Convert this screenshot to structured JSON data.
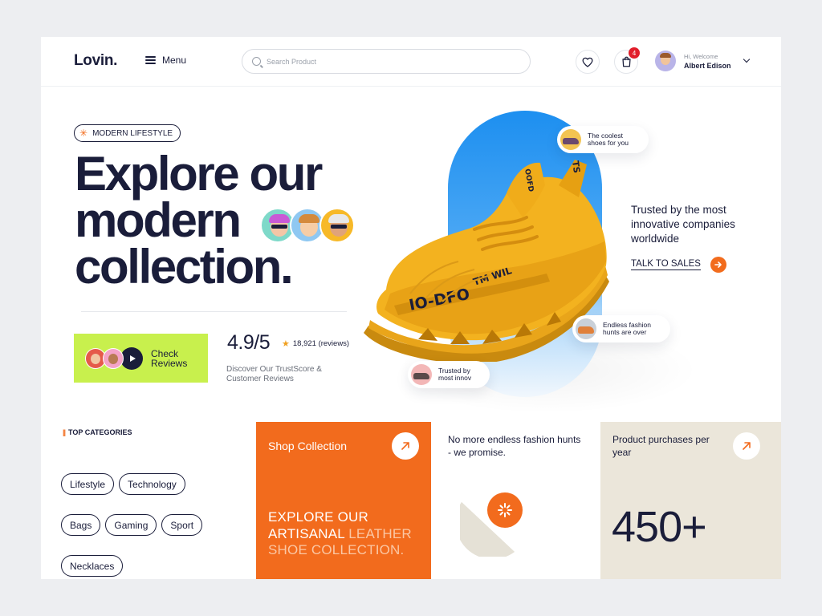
{
  "header": {
    "logo": "Lovin.",
    "menu_label": "Menu",
    "search_placeholder": "Search Product",
    "cart_count": "4",
    "user_greeting": "Hi, Welcome",
    "user_name": "Albert Edison"
  },
  "hero": {
    "tag": "MODERN LIFESTYLE",
    "title_line1": "Explore our",
    "title_line2": "modern",
    "title_line3": "collection.",
    "check_reviews_label": "Check Reviews",
    "rating": "4.9/5",
    "review_count": "18,921 (reviews)",
    "rating_desc": "Discover Our TrustScore & Customer Reviews"
  },
  "pills": {
    "coolest": "The coolest shoes for you",
    "endless": "Endless fashion hunts are over",
    "trusted_by": "Trusted by most innov"
  },
  "aside": {
    "trusted": "Trusted by the most innovative companies worldwide",
    "talk_to_sales": "TALK TO SALES"
  },
  "categories": {
    "heading": "TOP CATEGORIES",
    "heading_mark": "||",
    "items": [
      "Lifestyle",
      "Technology",
      "Bags",
      "Gaming",
      "Sport",
      "Necklaces"
    ]
  },
  "cards": {
    "shop_title": "Shop Collection",
    "shop_text_bright": "EXPLORE OUR ARTISANAL",
    "shop_text_dim": "LEATHER SHOE COLLECTION.",
    "promise": "No more endless fashion hunts - we promise.",
    "purchases_label": "Product purchases per year",
    "purchases_value": "450+"
  },
  "colors": {
    "accent_orange": "#f26b1d",
    "lime": "#c8f04d",
    "navy": "#1a1d3a",
    "beige": "#ebe6da",
    "sky_blue": "#1d8ff0"
  },
  "icons": [
    "hamburger-icon",
    "search-icon",
    "heart-icon",
    "shopping-bag-icon",
    "chevron-down-icon",
    "asterisk-icon",
    "play-icon",
    "star-icon",
    "arrow-right-icon",
    "arrow-up-right-icon"
  ]
}
